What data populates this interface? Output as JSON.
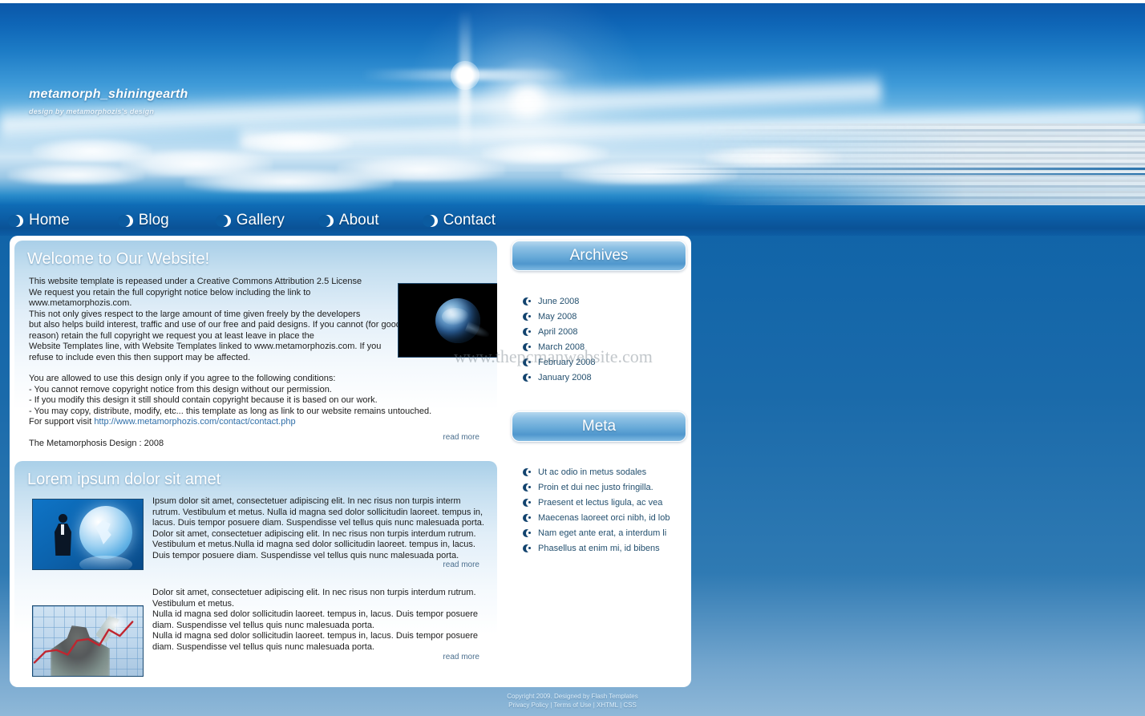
{
  "site": {
    "title": "metamorph_shiningearth",
    "tagline": "design by metamorphozis's design"
  },
  "nav": {
    "items": [
      {
        "label": "Home",
        "icon": "crescent-moon-icon"
      },
      {
        "label": "Blog",
        "icon": "crescent-moon-icon"
      },
      {
        "label": "Gallery",
        "icon": "crescent-moon-icon"
      },
      {
        "label": "About",
        "icon": "crescent-moon-icon"
      },
      {
        "label": "Contact",
        "icon": "crescent-moon-icon"
      }
    ]
  },
  "main": {
    "welcome": {
      "title": "Welcome to Our Website!",
      "para1": "This website template is repeased under a Creative Commons Attribution 2.5 License",
      "para2": "We request you retain the full copyright notice below including the link to",
      "para3": "www.metamorphozis.com.",
      "para4": "This not only gives respect to the large amount of time given freely by the developers",
      "para5": "but also helps build interest, traffic and use of our free and paid designs. If you cannot (for good",
      "para6": "reason) retain the full copyright we request you at least leave in place the",
      "para7": "Website Templates line, with Website Templates linked to www.metamorphozis.com. If you",
      "para8": "refuse to include even this then support may be affected.",
      "conditions_intro": "You are allowed to use this design only if you agree to the following conditions:",
      "condition1": "- You cannot remove copyright notice from this design without our permission.",
      "condition2": "- If you modify this design it still should contain copyright because it is based on our work.",
      "condition3": "- You may copy, distribute, modify, etc... this template as long as link to our website remains untouched.",
      "support_label": "For support visit ",
      "support_link": "http://www.metamorphozis.com/contact/contact.php",
      "signature": "The Metamorphosis Design : 2008",
      "read_more": "read more",
      "image_alt": "earth-from-space-photo"
    },
    "lorem": {
      "title": "Lorem ipsum dolor sit amet",
      "block1_text": "Ipsum dolor sit amet, consectetuer adipiscing elit. In nec risus non turpis interm rutrum. Vestibulum et metus. Nulla id magna sed dolor sollicitudin laoreet. tempus in, lacus. Duis tempor posuere diam. Suspendisse vel tellus quis nunc malesuada porta. Dolor sit amet, consectetuer adipiscing elit. In nec risus non turpis interdum rutrum. Vestibulum et metus.Nulla id magna sed dolor sollicitudin laoreet. tempus in, lacus. Duis tempor posuere diam. Suspendisse vel tellus quis nunc malesuada porta.",
      "block1_read_more": "read more",
      "block1_image_alt": "businessman-globe-thumbnail",
      "block2_line1": "Dolor sit amet, consectetuer adipiscing elit. In nec risus non turpis interdum rutrum. Vestibulum et metus.",
      "block2_line2": "Nulla id magna sed dolor sollicitudin laoreet. tempus in, lacus. Duis tempor posuere diam. Suspendisse vel tellus quis nunc malesuada porta.",
      "block2_line3": "Nulla id magna sed dolor sollicitudin laoreet. tempus in, lacus. Duis tempor posuere diam. Suspendisse vel tellus quis nunc malesuada porta.",
      "block2_read_more": "read more",
      "block2_image_alt": "business-growth-chart-thumbnail"
    }
  },
  "sidebar": {
    "archives": {
      "title": "Archives",
      "items": [
        {
          "label": "June 2008"
        },
        {
          "label": "May 2008"
        },
        {
          "label": "April 2008"
        },
        {
          "label": "March 2008"
        },
        {
          "label": "February 2008"
        },
        {
          "label": "January 2008"
        }
      ]
    },
    "meta": {
      "title": "Meta",
      "items": [
        {
          "label": "Ut ac odio in metus sodales"
        },
        {
          "label": "Proin et dui nec justo fringilla."
        },
        {
          "label": "Praesent et lectus ligula, ac vea"
        },
        {
          "label": "Maecenas laoreet orci nibh, id lob"
        },
        {
          "label": "Nam eget ante erat, a interdum li"
        },
        {
          "label": "Phasellus at enim mi, id bibens"
        }
      ]
    }
  },
  "watermark": {
    "text": "www.thepcmanwebsite.com"
  },
  "footer": {
    "copyright": "Copyright 2009. Designed by Flash Templates",
    "links": [
      {
        "label": "Privacy Policy"
      },
      {
        "label": "Terms of Use"
      },
      {
        "label": "XHTML"
      },
      {
        "label": "CSS"
      }
    ],
    "separator": " | "
  },
  "colors": {
    "page_background_top": "#0b5ba3",
    "page_background_bottom": "#8fb8d8",
    "nav_bar": "#0c5ea6",
    "accent_link": "#2e6ea8",
    "sidebar_header_blue": "#67a9d8",
    "text_dark": "#1d1d1d",
    "sidebar_item_text": "#24506f"
  }
}
